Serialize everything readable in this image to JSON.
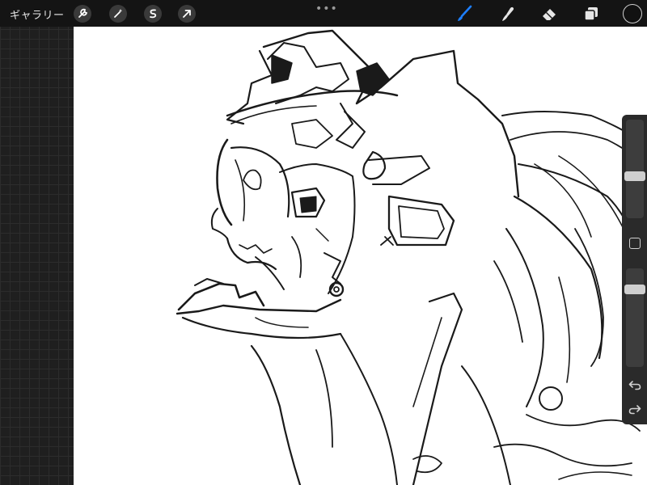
{
  "topbar": {
    "gallery_label": "ギャラリー",
    "left_tools": [
      "wrench-icon",
      "magic-wand-icon",
      "selection-icon",
      "transform-arrow-icon"
    ],
    "more_label": "•••",
    "right_tools": [
      "brush-icon",
      "smudge-icon",
      "eraser-icon",
      "layers-icon"
    ],
    "active_tool": "brush-icon",
    "active_color": "#1e7fff",
    "current_color": "#111111"
  },
  "sidebar": {
    "brush_size_level": 0.45,
    "opacity_level": 0.8,
    "icons": [
      "modify-square-icon",
      "undo-icon",
      "redo-icon"
    ]
  },
  "canvas": {
    "background": "#ffffff",
    "content": "sketch-drawing"
  }
}
